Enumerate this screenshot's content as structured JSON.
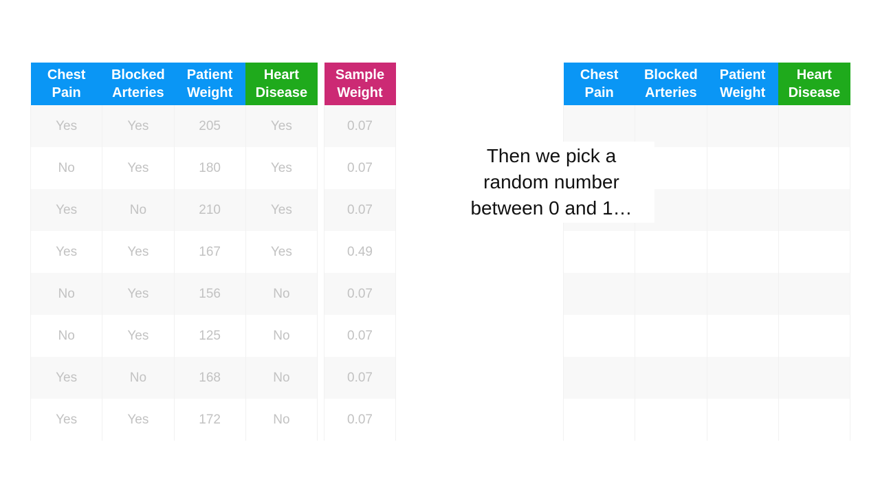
{
  "main_table": {
    "headers": [
      "Chest\nPain",
      "Blocked\nArteries",
      "Patient\nWeight",
      "Heart\nDisease"
    ],
    "rows": [
      [
        "Yes",
        "Yes",
        "205",
        "Yes"
      ],
      [
        "No",
        "Yes",
        "180",
        "Yes"
      ],
      [
        "Yes",
        "No",
        "210",
        "Yes"
      ],
      [
        "Yes",
        "Yes",
        "167",
        "Yes"
      ],
      [
        "No",
        "Yes",
        "156",
        "No"
      ],
      [
        "No",
        "Yes",
        "125",
        "No"
      ],
      [
        "Yes",
        "No",
        "168",
        "No"
      ],
      [
        "Yes",
        "Yes",
        "172",
        "No"
      ]
    ]
  },
  "weight_table": {
    "header": "Sample\nWeight",
    "values": [
      "0.07",
      "0.07",
      "0.07",
      "0.49",
      "0.07",
      "0.07",
      "0.07",
      "0.07"
    ]
  },
  "new_table": {
    "headers": [
      "Chest\nPain",
      "Blocked\nArteries",
      "Patient\nWeight",
      "Heart\nDisease"
    ],
    "row_count": 8
  },
  "caption": {
    "line1": "Then we pick a",
    "line2": "random number",
    "line3": "between 0 and 1…"
  },
  "colors": {
    "header_blue": "#0a96f5",
    "header_green": "#1faa1c",
    "header_pink": "#cc2a74"
  }
}
